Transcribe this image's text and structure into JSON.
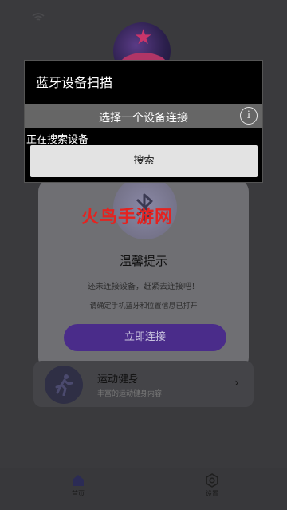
{
  "app": {
    "tip_card": {
      "watermark": "火鸟手游网",
      "title": "温馨提示",
      "text1": "还未连接设备，赶紧去连接吧！",
      "text2": "请确定手机蓝牙和位置信息已打开",
      "connect_button": "立即连接"
    },
    "sport_card": {
      "title": "运动健身",
      "subtitle": "丰富的运动健身内容"
    },
    "tabbar": {
      "home_label": "首页",
      "settings_label": "设置"
    }
  },
  "dialog": {
    "title": "蓝牙设备扫描",
    "subtitle": "选择一个设备连接",
    "info_icon": "i",
    "status": "正在搜索设备",
    "search_button": "搜索"
  },
  "colors": {
    "accent_purple": "#4a2c8a",
    "watermark_red": "#e42320",
    "dialog_bg": "#000000",
    "dialog_sub_bg": "#666666"
  },
  "icons": [
    "wifi-icon",
    "bluetooth-icon",
    "runner-icon",
    "chevron-right-icon",
    "home-icon",
    "gear-icon",
    "info-icon"
  ]
}
